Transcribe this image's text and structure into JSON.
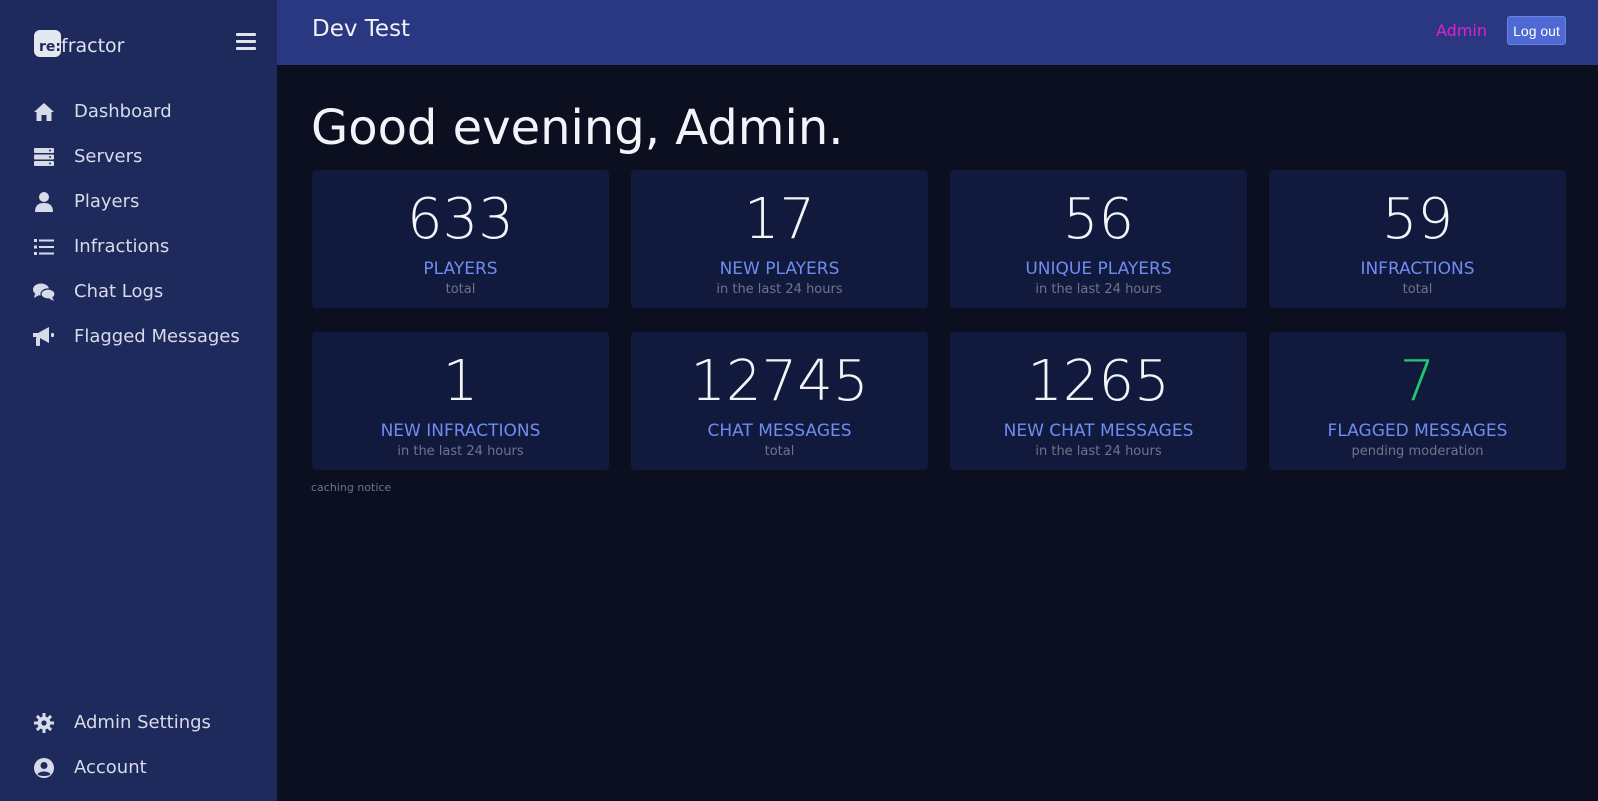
{
  "sidebar": {
    "brand_mark": "re:",
    "brand_text": "fractor",
    "items": [
      {
        "label": "Dashboard",
        "icon": "home-icon"
      },
      {
        "label": "Servers",
        "icon": "server-icon"
      },
      {
        "label": "Players",
        "icon": "user-icon"
      },
      {
        "label": "Infractions",
        "icon": "list-icon"
      },
      {
        "label": "Chat Logs",
        "icon": "chat-icon"
      },
      {
        "label": "Flagged Messages",
        "icon": "megaphone-icon"
      }
    ],
    "bottom_items": [
      {
        "label": "Admin Settings",
        "icon": "gear-icon"
      },
      {
        "label": "Account",
        "icon": "user-circle-icon"
      }
    ]
  },
  "header": {
    "title": "Dev Test",
    "user": "Admin",
    "logout_label": "Log out"
  },
  "main": {
    "greeting": "Good evening, Admin.",
    "stats": [
      {
        "value": "633",
        "label": "PLAYERS",
        "sub": "total"
      },
      {
        "value": "17",
        "label": "NEW PLAYERS",
        "sub": "in the last 24 hours"
      },
      {
        "value": "56",
        "label": "UNIQUE PLAYERS",
        "sub": "in the last 24 hours"
      },
      {
        "value": "59",
        "label": "INFRACTIONS",
        "sub": "total"
      },
      {
        "value": "1",
        "label": "NEW INFRACTIONS",
        "sub": "in the last 24 hours"
      },
      {
        "value": "12745",
        "label": "CHAT MESSAGES",
        "sub": "total"
      },
      {
        "value": "1265",
        "label": "NEW CHAT MESSAGES",
        "sub": "in the last 24 hours"
      },
      {
        "value": "7",
        "label": "FLAGGED MESSAGES",
        "sub": "pending moderation"
      }
    ],
    "caching_notice": "caching notice"
  },
  "colors": {
    "sidebar_bg": "#1f2a5c",
    "topbar_bg": "#2a3781",
    "page_bg": "#0b0f1f",
    "card_bg": "#111a3d",
    "label_blue": "#6f8cf0",
    "flagged_green": "#22c870",
    "user_magenta": "#e11fd0"
  }
}
